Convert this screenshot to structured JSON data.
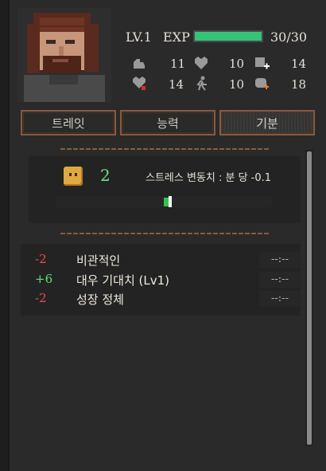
{
  "header": {
    "level": "LV.1",
    "exp_label": "EXP",
    "exp_value": "30/30",
    "exp_fraction": 1.0
  },
  "stats": [
    {
      "icon": "strength-arm-icon",
      "value": "11"
    },
    {
      "icon": "heart-icon",
      "value": "10"
    },
    {
      "icon": "fist-plus-icon",
      "value": "14"
    },
    {
      "icon": "broken-heart-icon",
      "value": "14"
    },
    {
      "icon": "running-person-icon",
      "value": "10"
    },
    {
      "icon": "brain-plus-icon",
      "value": "18"
    }
  ],
  "tabs": [
    {
      "label": "트레잇",
      "active": false
    },
    {
      "label": "능력",
      "active": false
    },
    {
      "label": "기분",
      "active": true
    }
  ],
  "stress": {
    "icon": "neutral-face-icon",
    "value": "2",
    "rate_text": "스트레스 변동치 :  분 당 -0.1",
    "level_fraction": 0.52
  },
  "traits": [
    {
      "value": "-2",
      "name": "비관적인",
      "duration": "--:--",
      "polarity": "negative"
    },
    {
      "value": "+6",
      "name": "대우 기대치 (Lv1)",
      "duration": "--:--",
      "polarity": "positive"
    },
    {
      "value": "-2",
      "name": "성장 정체",
      "duration": "--:--",
      "polarity": "negative"
    }
  ],
  "colors": {
    "exp_bar": "#35c37a",
    "positive": "#5fe07a",
    "negative": "#f04848",
    "tab_border": "#8a5a3e"
  }
}
